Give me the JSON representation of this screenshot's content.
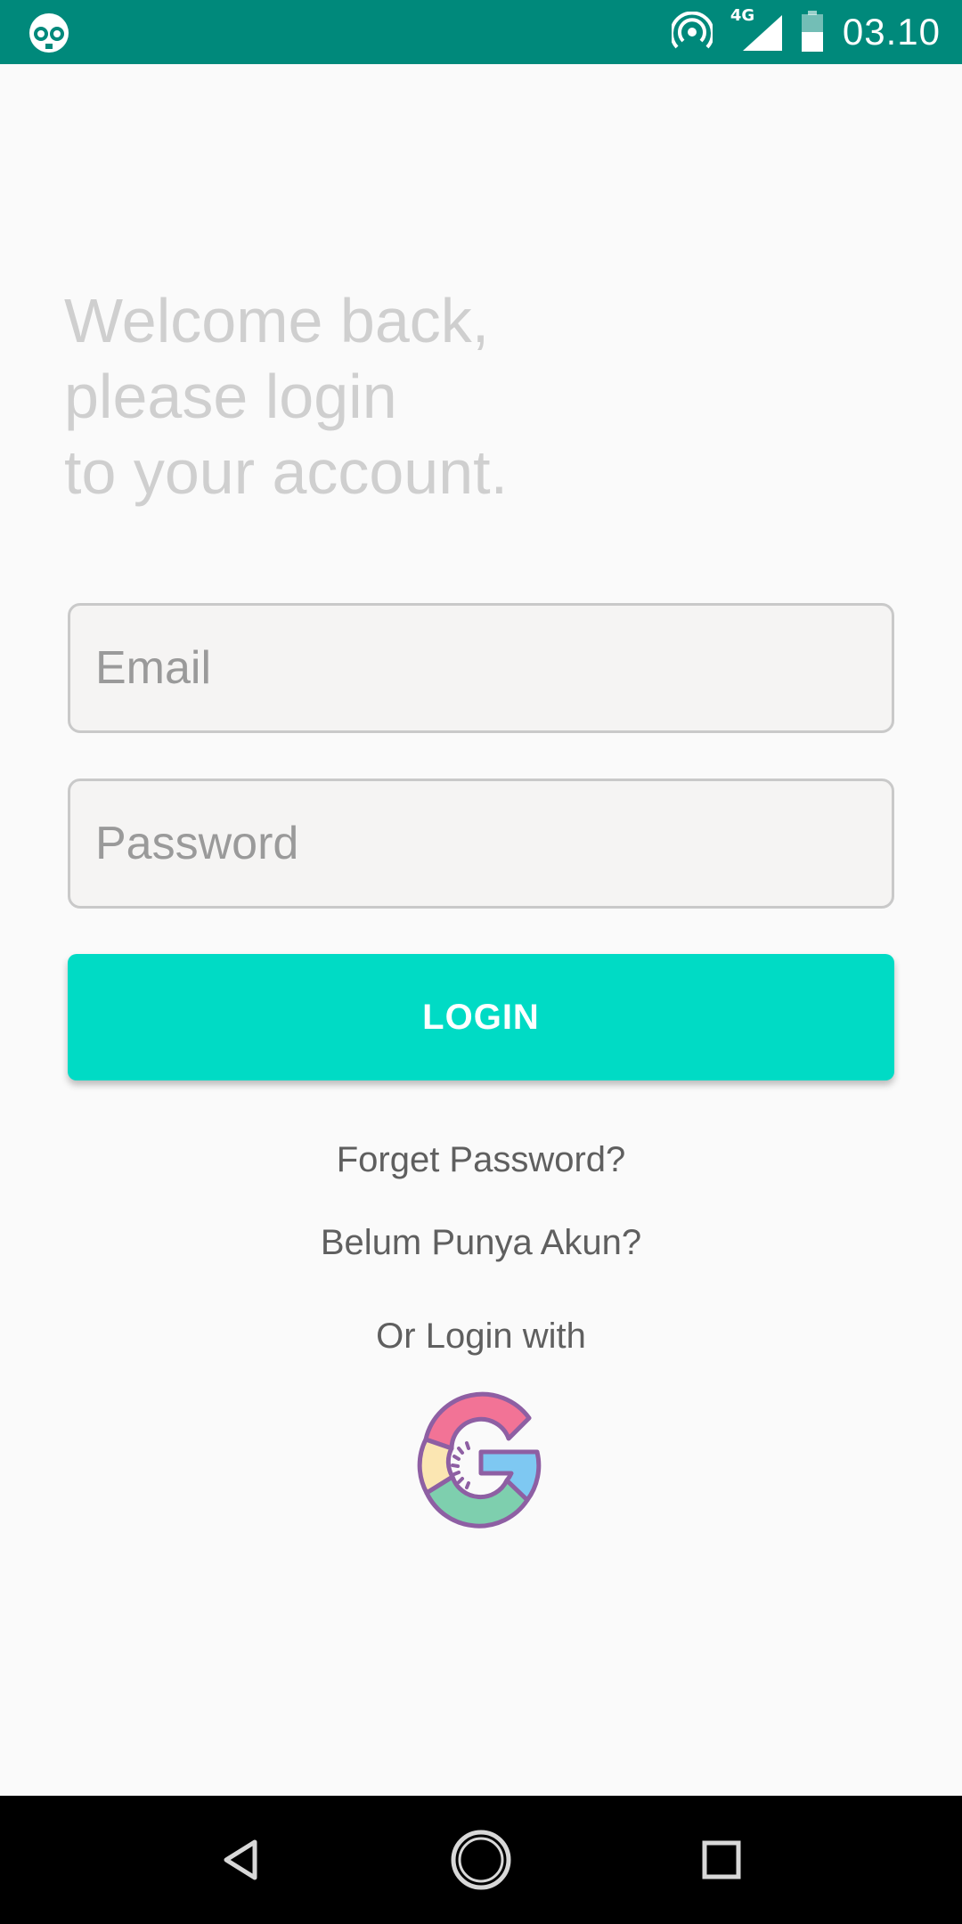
{
  "status_bar": {
    "time": "03.10",
    "network_type": "4G",
    "background_color": "#00897b",
    "icons": [
      "app-notification-icon",
      "hotspot-icon",
      "signal-icon",
      "battery-icon"
    ]
  },
  "welcome": {
    "line1": "Welcome back,",
    "line2": "please login",
    "line3": "to your account."
  },
  "form": {
    "email_placeholder": "Email",
    "email_value": "",
    "password_placeholder": "Password",
    "password_value": ""
  },
  "login_button": {
    "label": "LOGIN",
    "color": "#00dbc5"
  },
  "links": {
    "forget_password": "Forget Password?",
    "register": "Belum Punya Akun?",
    "or_login_with": "Or Login with"
  },
  "social": {
    "google_icon": "google-logo-icon"
  },
  "nav_bar": {
    "icons": [
      "back-icon",
      "home-icon",
      "recents-icon"
    ]
  }
}
